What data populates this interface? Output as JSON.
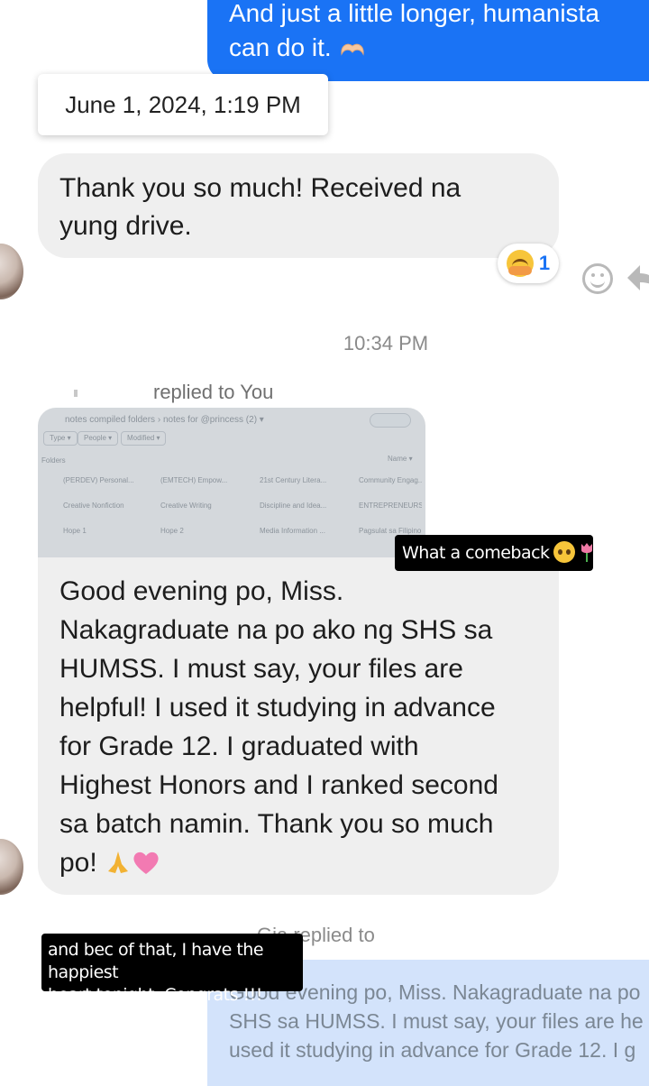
{
  "top_sent_message": {
    "lines": [
      "And just a little longer, humanista",
      "can do it."
    ],
    "emoji_icon": "heart-hands-icon"
  },
  "date_card": {
    "text": "June 1, 2024, 1:19 PM"
  },
  "received_message_1": {
    "lines": [
      "Thank you so much! Received na",
      "yung drive."
    ]
  },
  "reaction": {
    "emoji_icon": "hugging-face-icon",
    "count": "1"
  },
  "timestamp": "10:34 PM",
  "reply_header": {
    "label": "replied to You"
  },
  "attached_screenshot": {
    "breadcrumb": "notes compiled folders  ›  notes for @princess (2)  ▾",
    "chips": [
      "Type ▾",
      "People ▾",
      "Modified ▾"
    ],
    "section": "Folders",
    "sort": "Name ▾",
    "folders": [
      "(PERDEV) Personal...",
      "(EMTECH) Empow...",
      "21st Century Litera...",
      "Community Engag...",
      "Creative Nonfiction",
      "Creative Writing",
      "Discipline and Idea...",
      "ENTREPRENEURSHI...",
      "Hope 1",
      "Hope 2",
      "Media Information ...",
      "Pagsulat sa Filipino..."
    ]
  },
  "received_message_2": {
    "lines": [
      "Good evening po, Miss.",
      "Nakagraduate na po ako ng SHS sa",
      "HUMSS. I must say, your files are",
      "helpful! I used it studying in advance",
      "for Grade 12. I graduated with",
      "Highest Honors and I ranked second",
      "sa batch namin. Thank you so much",
      "po!"
    ],
    "emoji_icons": [
      "folded-hands-icon",
      "pink-heart-icon"
    ]
  },
  "sticker_1": {
    "text": "What a comeback",
    "emoji_icons": [
      "pleading-face-icon",
      "tulip-icon"
    ]
  },
  "sticker_2": {
    "lines": [
      "and bec of that, I have the happiest",
      "heart tonight. Congrats !!!"
    ]
  },
  "reply_header_2": {
    "label": "Gia replied to"
  },
  "sent_quote": {
    "lines": [
      "Good evening po, Miss. Nakagraduate na po",
      "SHS sa HUMSS. I must say, your files are he",
      "used it studying in advance for Grade 12. I g"
    ]
  },
  "colors": {
    "sent_bubble": "#1a73f5",
    "received_bubble": "#efefef",
    "quote_bubble": "#d3e3fb",
    "reaction_count": "#1a73f5",
    "sticker_bg": "#000000"
  }
}
